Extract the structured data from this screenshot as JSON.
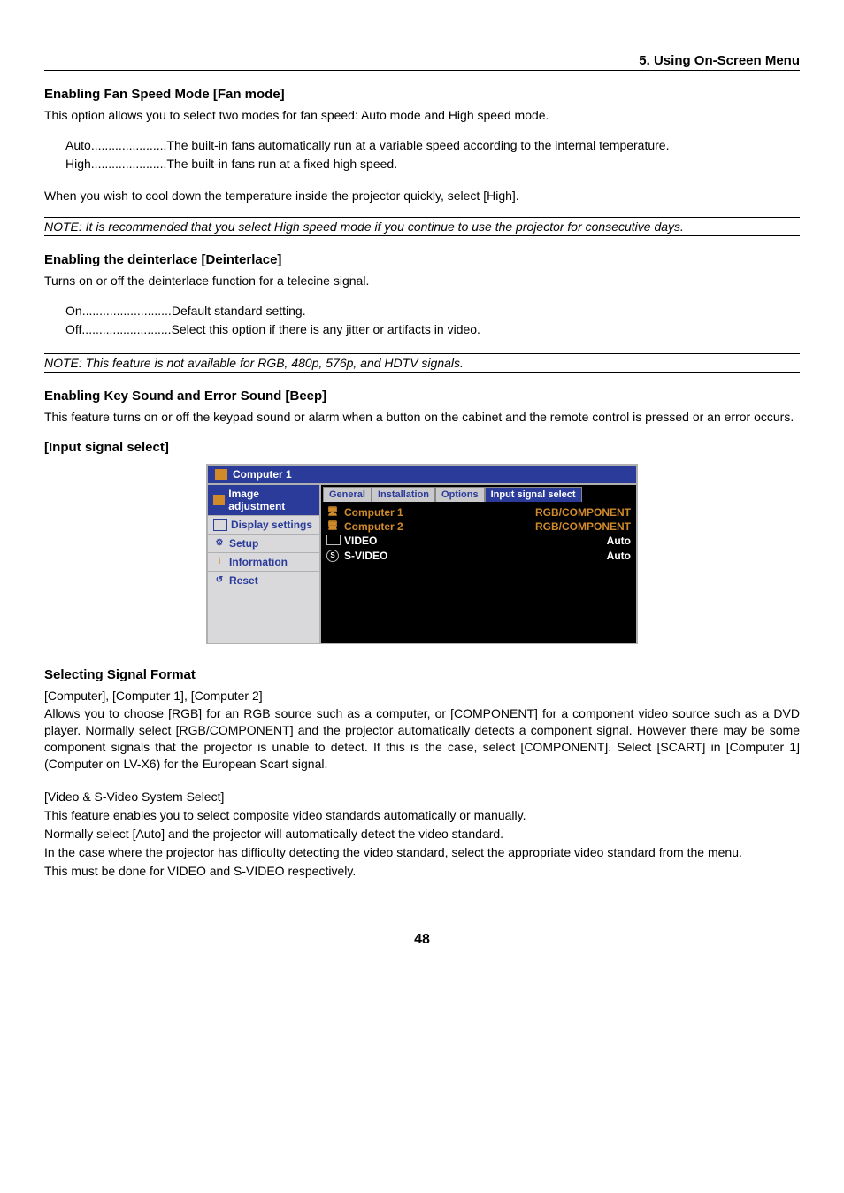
{
  "header": {
    "chapter": "5. Using On-Screen Menu"
  },
  "fan": {
    "title": "Enabling Fan Speed Mode [Fan mode]",
    "intro": "This option allows you to select two modes for fan speed: Auto mode and High speed mode.",
    "defs": [
      {
        "term": "Auto",
        "dots": " ...................... ",
        "desc": "The built-in fans automatically run at a variable speed according to the internal temperature."
      },
      {
        "term": "High",
        "dots": " ...................... ",
        "desc": "The built-in fans run at a fixed high speed."
      }
    ],
    "after": "When you wish to cool down the temperature inside the projector quickly, select [High].",
    "note": "NOTE: It is recommended that you select High speed mode if you continue to use the projector for consecutive days."
  },
  "deint": {
    "title": "Enabling the deinterlace [Deinterlace]",
    "intro": "Turns on or off the deinterlace function for a telecine signal.",
    "defs": [
      {
        "term": "On",
        "dots": " .......................... ",
        "desc": "Default standard setting."
      },
      {
        "term": "Off",
        "dots": " .......................... ",
        "desc": "Select this option if there is any jitter or artifacts in video."
      }
    ],
    "note": "NOTE: This feature is not available for RGB, 480p, 576p, and HDTV signals."
  },
  "beep": {
    "title": "Enabling Key Sound and Error Sound [Beep]",
    "text": "This feature turns on or off the keypad sound or alarm when a button on the cabinet and the remote control is pressed or an error occurs."
  },
  "input_select": {
    "heading": "[Input signal select]",
    "osd": {
      "title": "Computer 1",
      "sidebar": [
        {
          "label": "Image adjustment",
          "selected": true
        },
        {
          "label": "Display settings"
        },
        {
          "label": "Setup"
        },
        {
          "label": "Information"
        },
        {
          "label": "Reset"
        }
      ],
      "tabs": [
        "General",
        "Installation",
        "Options",
        "Input signal select"
      ],
      "active_tab": "Input signal select",
      "rows": [
        {
          "left": "Computer 1",
          "right": "RGB/COMPONENT",
          "highlight": true,
          "icon": "monitor"
        },
        {
          "left": "Computer 2",
          "right": "RGB/COMPONENT",
          "highlight": true,
          "icon": "monitor"
        },
        {
          "left": "VIDEO",
          "right": "Auto",
          "highlight": false,
          "icon": "scart"
        },
        {
          "left": "S-VIDEO",
          "right": "Auto",
          "highlight": false,
          "icon": "s"
        }
      ]
    }
  },
  "signal": {
    "title": "Selecting Signal Format",
    "sub1": "[Computer], [Computer 1], [Computer 2]",
    "p1": "Allows you to choose [RGB] for an RGB source such as a computer, or [COMPONENT] for a component video source such as a DVD player. Normally select [RGB/COMPONENT] and the projector automatically detects a component signal. However there may be some component signals that the projector is unable to detect. If this is the case, select [COMPONENT]. Select [SCART] in [Computer 1] (Computer on LV-X6) for the European Scart signal.",
    "sub2": "[Video & S-Video System Select]",
    "p2a": "This feature enables you to select composite video standards automatically or manually.",
    "p2b": "Normally select [Auto] and the projector will automatically detect the video standard.",
    "p2c": "In the case where the projector has difficulty detecting the video standard, select the appropriate video standard from the menu.",
    "p2d": "This must be done for VIDEO and S-VIDEO respectively."
  },
  "page_number": "48"
}
